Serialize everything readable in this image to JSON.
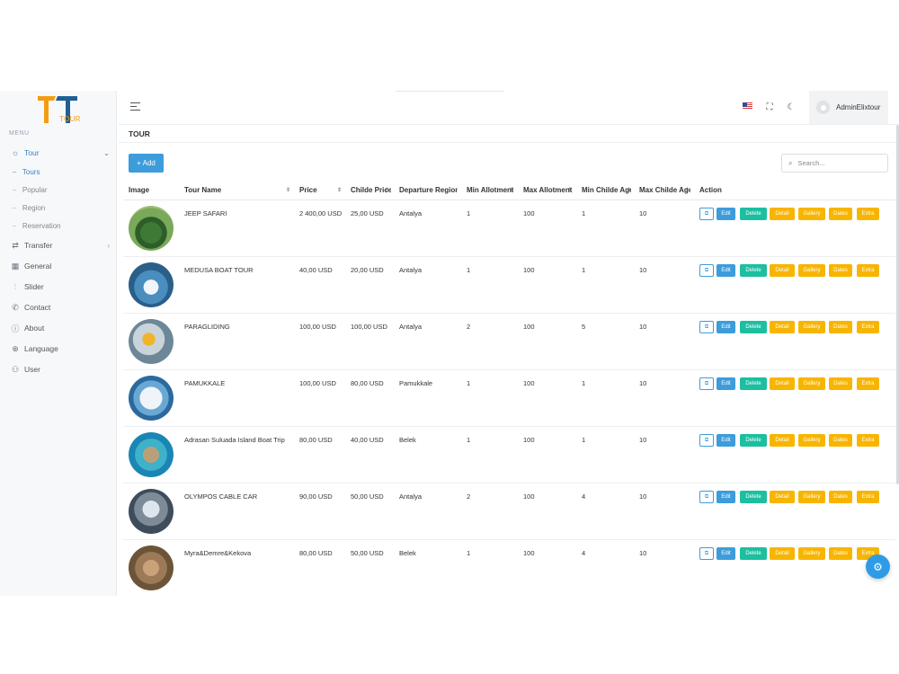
{
  "brand": {
    "logo_text": "TOUR",
    "colors": {
      "primary": "#3d9cdb",
      "accent": "#f39c12",
      "success": "#1cbfa0",
      "warning": "#f8b500"
    }
  },
  "sidebar": {
    "menu_title": "MENU",
    "items": [
      {
        "label": "Tour",
        "icon": "sun-icon",
        "active": true
      },
      {
        "label": "Transfer",
        "icon": "swap-icon"
      },
      {
        "label": "General",
        "icon": "grid-icon"
      },
      {
        "label": "Slider",
        "icon": "sliders-icon"
      },
      {
        "label": "Contact",
        "icon": "phone-icon"
      },
      {
        "label": "About",
        "icon": "info-icon"
      },
      {
        "label": "Language",
        "icon": "globe-icon"
      },
      {
        "label": "User",
        "icon": "users-icon"
      }
    ],
    "tour_sub": [
      "Tours",
      "Popular",
      "Region",
      "Reservation"
    ]
  },
  "header": {
    "username": "AdminElixtour"
  },
  "page": {
    "title": "TOUR",
    "add_label": "+ Add",
    "search_placeholder": "Search..."
  },
  "table": {
    "columns": [
      "Image",
      "Tour Name",
      "Price",
      "Childe Price",
      "Departure Region",
      "Min Allotment",
      "Max Allotment",
      "Min Childe Age",
      "Max Childe Age",
      "Action"
    ],
    "actions": [
      "Edit",
      "Delete",
      "Detail",
      "Gallery",
      "Dates",
      "Extra"
    ],
    "rows": [
      {
        "name": "JEEP SAFARI",
        "price": "2 400,00 USD",
        "child_price": "25,00 USD",
        "region": "Antalya",
        "min_allot": "1",
        "max_allot": "100",
        "min_age": "1",
        "max_age": "10"
      },
      {
        "name": "MEDUSA BOAT TOUR",
        "price": "40,00 USD",
        "child_price": "20,00 USD",
        "region": "Antalya",
        "min_allot": "1",
        "max_allot": "100",
        "min_age": "1",
        "max_age": "10"
      },
      {
        "name": "PARAGLIDING",
        "price": "100,00 USD",
        "child_price": "100,00 USD",
        "region": "Antalya",
        "min_allot": "2",
        "max_allot": "100",
        "min_age": "5",
        "max_age": "10"
      },
      {
        "name": "PAMUKKALE",
        "price": "100,00 USD",
        "child_price": "80,00 USD",
        "region": "Pamukkale",
        "min_allot": "1",
        "max_allot": "100",
        "min_age": "1",
        "max_age": "10"
      },
      {
        "name": "Adrasan Suluada Island Boat Trip",
        "price": "80,00 USD",
        "child_price": "40,00 USD",
        "region": "Belek",
        "min_allot": "1",
        "max_allot": "100",
        "min_age": "1",
        "max_age": "10"
      },
      {
        "name": "OLYMPOS CABLE CAR",
        "price": "90,00 USD",
        "child_price": "50,00 USD",
        "region": "Antalya",
        "min_allot": "2",
        "max_allot": "100",
        "min_age": "4",
        "max_age": "10"
      },
      {
        "name": "Myra&Demre&Kekova",
        "price": "80,00 USD",
        "child_price": "50,00 USD",
        "region": "Belek",
        "min_allot": "1",
        "max_allot": "100",
        "min_age": "4",
        "max_age": "10"
      }
    ]
  }
}
